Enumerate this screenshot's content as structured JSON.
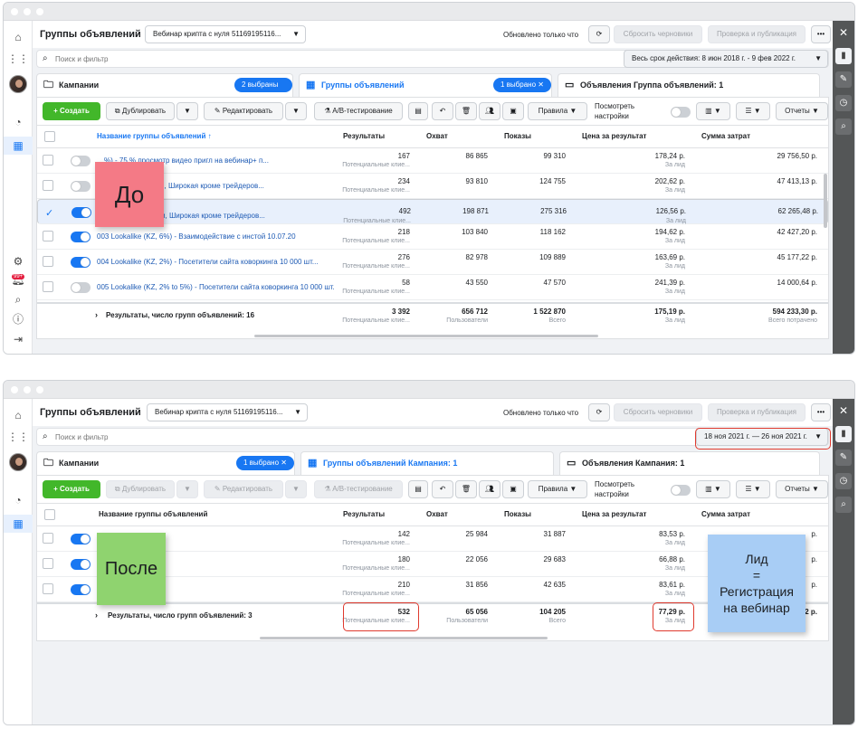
{
  "common": {
    "title": "Группы объявлений",
    "campaign_select": "Вебинар крипта с нуля 51169195116...",
    "updated": "Обновлено только что",
    "reset_drafts": "Сбросить черновики",
    "review_publish": "Проверка и публикация",
    "more": "•••",
    "search_placeholder": "Поиск и фильтр",
    "tab_campaigns": "Кампании",
    "create": "+ Создать",
    "duplicate": "Дублировать",
    "edit": "Редактировать",
    "ab_test": "A/B-тестирование",
    "rules": "Правила",
    "view_settings": "Посмотреть настройки",
    "reports": "Отчеты",
    "new_badge": "99+",
    "columns": {
      "name": "Название группы объявлений",
      "results": "Результаты",
      "reach": "Охват",
      "impressions": "Показы",
      "cpr": "Цена за результат",
      "spend": "Сумма затрат"
    },
    "sub_results": "Потенциальные клие...",
    "sub_results_total": "Потенциальные клие...",
    "sub_cpr": "За лид",
    "sub_reach_total": "Пользователи",
    "sub_impr_total": "Всего",
    "sub_spend_total": "Всего потрачено"
  },
  "before": {
    "sticky": "До",
    "date_range": "Весь срок действия: 8 июн 2018 г. - 9 фев 2022 г.",
    "campaigns_pill": "2 выбраны",
    "tab_adsets": "Группы объявлений",
    "adsets_pill": "1 выбрано",
    "tab_ads": "Объявления Группа объявлений: 1",
    "name_header": "Название группы объявлений ↑",
    "rows": [
      {
        "name": "…%) - 75 % просмотр видео пригл на вебинар+ п...",
        "results": "167",
        "reach": "86 865",
        "impressions": "99 310",
        "cpr": "178,24 р.",
        "spend": "29 756,50 р.",
        "on": false,
        "selected": false
      },
      {
        "name": "…предприниматели, Широкая кроме трейдеров...",
        "results": "234",
        "reach": "93 810",
        "impressions": "124 755",
        "cpr": "202,62 р.",
        "spend": "47 413,13 р.",
        "on": false,
        "selected": false
      },
      {
        "name": "…предприниматели, Широкая кроме трейдеров...",
        "results": "492",
        "reach": "198 871",
        "impressions": "275 316",
        "cpr": "126,56 р.",
        "spend": "62 265,48 р.",
        "on": true,
        "selected": true
      },
      {
        "name": "003 Lookalike (KZ, 6%) - Взаимодействие с инстой 10.07.20",
        "results": "218",
        "reach": "103 840",
        "impressions": "118 162",
        "cpr": "194,62 р.",
        "spend": "42 427,20 р.",
        "on": true,
        "selected": false
      },
      {
        "name": "004 Lookalike (KZ, 2%) - Посетители сайта коворкинга 10 000 шт...",
        "results": "276",
        "reach": "82 978",
        "impressions": "109 889",
        "cpr": "163,69 р.",
        "spend": "45 177,22 р.",
        "on": true,
        "selected": false
      },
      {
        "name": "005 Lookalike (KZ, 2% to 5%) - Посетители сайта коворкинга 10 000 шт...",
        "results": "58",
        "reach": "43 550",
        "impressions": "47 570",
        "cpr": "241,39 р.",
        "spend": "14 000,64 р.",
        "on": false,
        "selected": false
      }
    ],
    "total_label": "Результаты, число групп объявлений: 16",
    "total": {
      "results": "3 392",
      "reach": "656 712",
      "impressions": "1 522 870",
      "cpr": "175,19 р.",
      "spend": "594 233,30 р."
    }
  },
  "after": {
    "sticky": "После",
    "sticky2": "Лид\n=\nРегистрация\nна вебинар",
    "date_range": "18 ноя 2021 г. — 26 ноя 2021 г.",
    "campaigns_pill": "1 выбрано",
    "tab_adsets": "Группы объявлений Кампания: 1",
    "tab_ads": "Объявления Кампания: 1",
    "rows": [
      {
        "results": "142",
        "reach": "25 984",
        "impressions": "31 887",
        "cpr": "83,53 р.",
        "spend": "р.",
        "on": true
      },
      {
        "results": "180",
        "reach": "22 056",
        "impressions": "29 683",
        "cpr": "66,88 р.",
        "spend": "р.",
        "on": true
      },
      {
        "results": "210",
        "reach": "31 856",
        "impressions": "42 635",
        "cpr": "83,61 р.",
        "spend": "р.",
        "on": true
      }
    ],
    "total_label": "Результаты, число групп объявлений: 3",
    "total": {
      "results": "532",
      "reach": "65 056",
      "impressions": "104 205",
      "cpr": "77,29 р.",
      "spend": "22 р."
    }
  },
  "colors": {
    "accent": "#1877f2",
    "sticky_before": "#f47a86",
    "sticky_after": "#8fd36f",
    "sticky_note": "#a8cdf5",
    "highlight": "#e03a2e"
  }
}
